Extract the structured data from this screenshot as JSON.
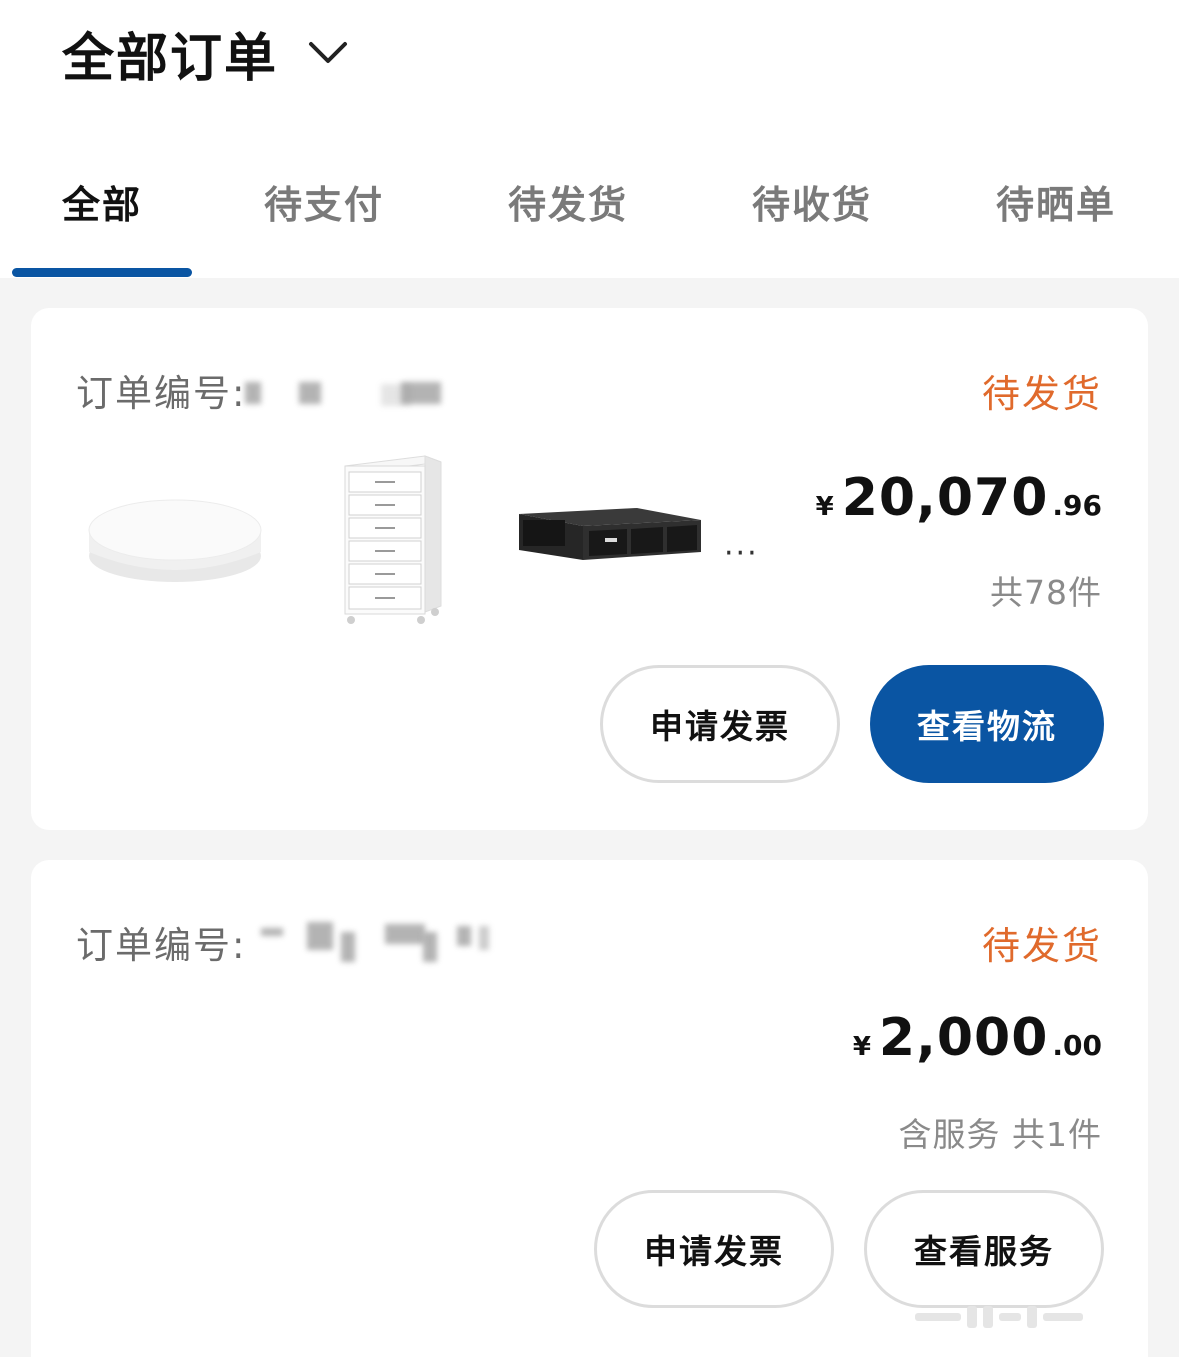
{
  "header": {
    "title": "全部订单"
  },
  "tabs": [
    {
      "label": "全部",
      "active": true
    },
    {
      "label": "待支付",
      "active": false
    },
    {
      "label": "待发货",
      "active": false
    },
    {
      "label": "待收货",
      "active": false
    },
    {
      "label": "待晒单",
      "active": false
    }
  ],
  "colors": {
    "accent": "#0a55a3",
    "status": "#e06a2c"
  },
  "orders": [
    {
      "order_no_label": "订单编号:",
      "status": "待发货",
      "currency": "¥",
      "price_int": "20,070",
      "price_dec": ".96",
      "count": "共78件",
      "more": "···",
      "products": [
        "ceiling-lamp-image",
        "drawer-cabinet-image",
        "tv-bench-image"
      ],
      "buttons": {
        "invoice": "申请发票",
        "primary": "查看物流"
      }
    },
    {
      "order_no_label": "订单编号:",
      "status": "待发货",
      "currency": "¥",
      "price_int": "2,000",
      "price_dec": ".00",
      "count": "含服务 共1件",
      "buttons": {
        "invoice": "申请发票",
        "service": "查看服务"
      }
    }
  ]
}
